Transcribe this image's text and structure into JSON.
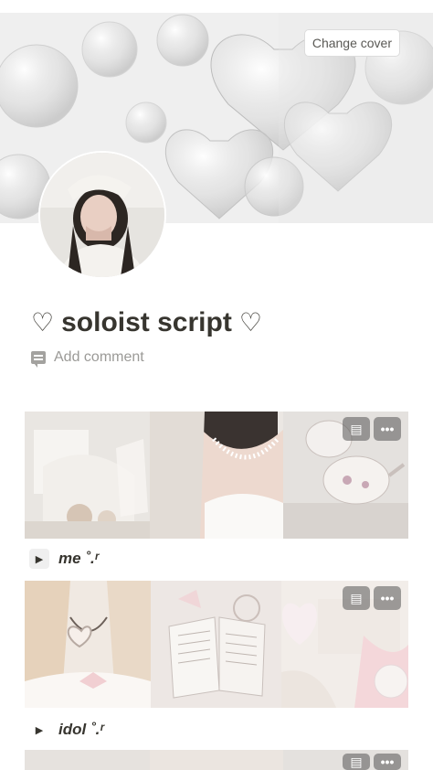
{
  "page": {
    "title": "soloist script",
    "heart_left": "♡",
    "heart_right": "♡",
    "add_comment_label": "Add comment",
    "change_cover_label": "Change cover"
  },
  "sections": [
    {
      "label": "me ˚.ʳ",
      "toggle_icon": "triangle-right-icon"
    },
    {
      "label": "idol ˚.ʳ",
      "toggle_icon": "triangle-right-icon"
    }
  ],
  "overlay": {
    "comment_glyph": "▤",
    "more_glyph": "•••"
  },
  "colors": {
    "text": "#37352f",
    "muted": "#9b9a97",
    "background": "#ffffff"
  }
}
